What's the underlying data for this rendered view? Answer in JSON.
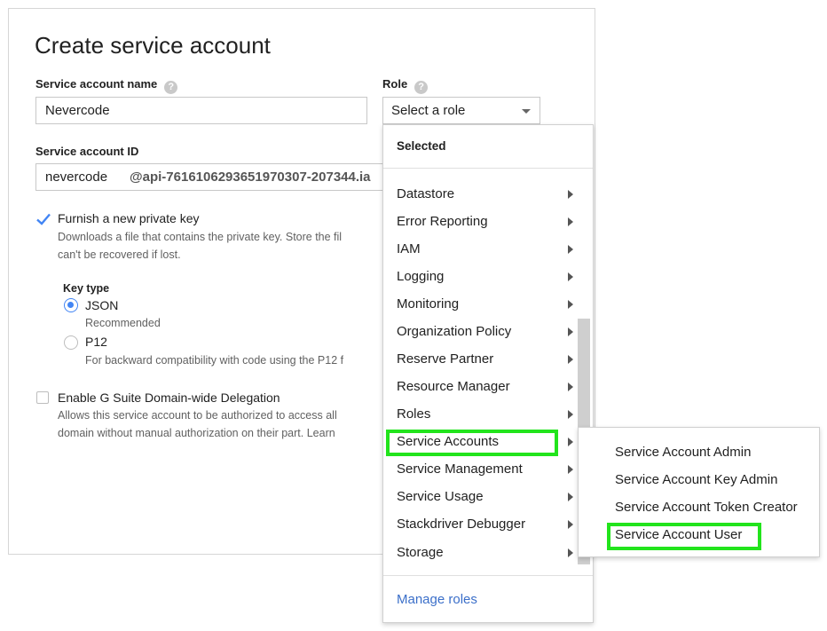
{
  "dialog": {
    "title": "Create service account",
    "name_label": "Service account name",
    "name_value": "Nevercode",
    "role_label": "Role",
    "role_select_value": "Select a role",
    "id_label": "Service account ID",
    "id_value": "nevercode",
    "id_suffix": "@api-7616106293651970307-207344.ia",
    "help_glyph": "?"
  },
  "private_key": {
    "checked": true,
    "label": "Furnish a new private key",
    "desc_line1": "Downloads a file that contains the private key. Store the fil",
    "desc_line2": "can't be recovered if lost."
  },
  "key_type": {
    "label": "Key type",
    "options": [
      {
        "label": "JSON",
        "desc": "Recommended",
        "selected": true
      },
      {
        "label": "P12",
        "desc": "For backward compatibility with code using the P12 f",
        "selected": false
      }
    ]
  },
  "delegation": {
    "checked": false,
    "label": "Enable G Suite Domain-wide Delegation",
    "desc_line1": "Allows this service account to be authorized to access all",
    "desc_line2": "domain without manual authorization on their part. Learn"
  },
  "role_menu": {
    "selected_header": "Selected",
    "items": [
      "Datastore",
      "Error Reporting",
      "IAM",
      "Logging",
      "Monitoring",
      "Organization Policy",
      "Reserve Partner",
      "Resource Manager",
      "Roles",
      "Service Accounts",
      "Service Management",
      "Service Usage",
      "Stackdriver Debugger",
      "Storage"
    ],
    "highlighted_item": "Service Accounts",
    "manage_roles": "Manage roles"
  },
  "submenu": {
    "items": [
      "Service Account Admin",
      "Service Account Key Admin",
      "Service Account Token Creator",
      "Service Account User"
    ],
    "highlighted_item": "Service Account User"
  },
  "colors": {
    "highlight": "#22e41c",
    "accent": "#4285f4",
    "link": "#3b6fc9"
  }
}
